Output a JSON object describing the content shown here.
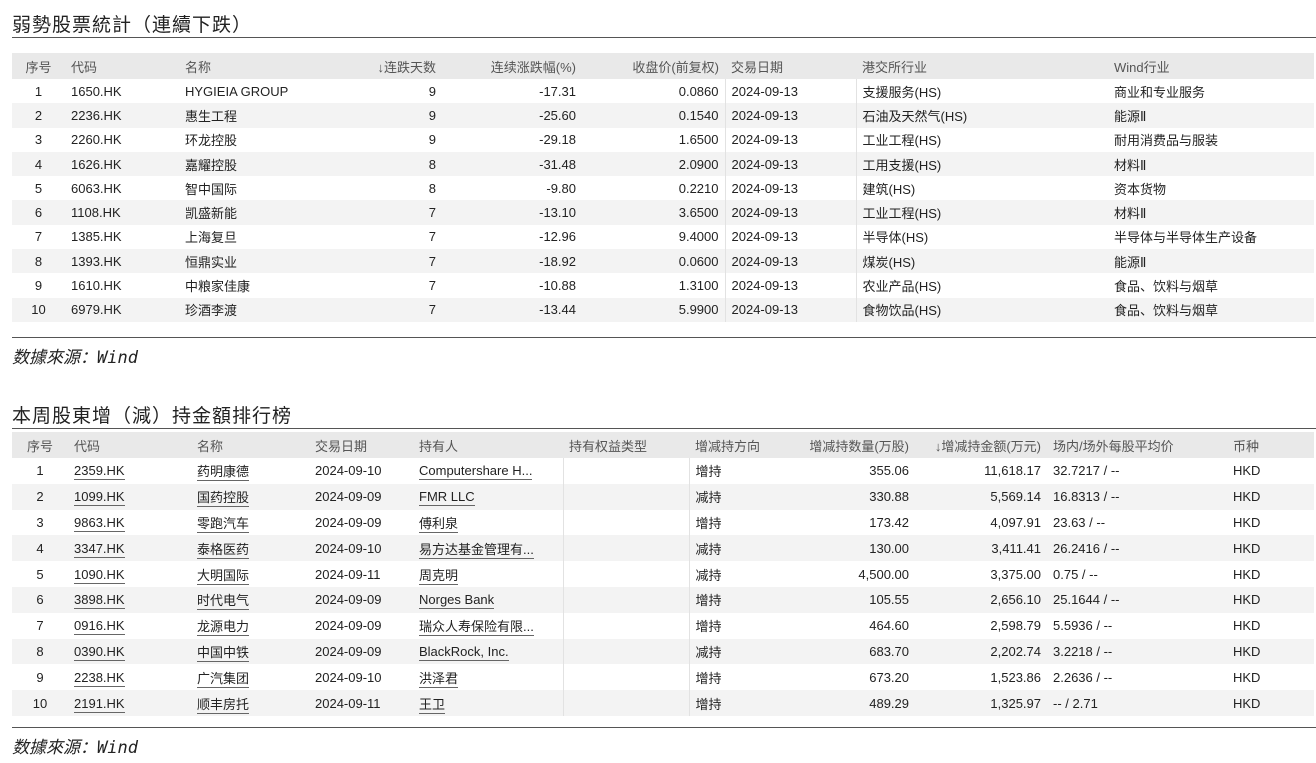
{
  "section1": {
    "title": "弱勢股票統計（連續下跌）",
    "headers": [
      "序号",
      "代码",
      "名称",
      "↓连跌天数",
      "连续涨跌幅(%)",
      "收盘价(前复权)",
      "交易日期",
      "港交所行业",
      "Wind行业"
    ],
    "rows": [
      [
        "1",
        "1650.HK",
        "HYGIEIA GROUP",
        "9",
        "-17.31",
        "0.0860",
        "2024-09-13",
        "支援服务(HS)",
        "商业和专业服务"
      ],
      [
        "2",
        "2236.HK",
        "惠生工程",
        "9",
        "-25.60",
        "0.1540",
        "2024-09-13",
        "石油及天然气(HS)",
        "能源Ⅱ"
      ],
      [
        "3",
        "2260.HK",
        "环龙控股",
        "9",
        "-29.18",
        "1.6500",
        "2024-09-13",
        "工业工程(HS)",
        "耐用消费品与服装"
      ],
      [
        "4",
        "1626.HK",
        "嘉耀控股",
        "8",
        "-31.48",
        "2.0900",
        "2024-09-13",
        "工用支援(HS)",
        "材料Ⅱ"
      ],
      [
        "5",
        "6063.HK",
        "智中国际",
        "8",
        "-9.80",
        "0.2210",
        "2024-09-13",
        "建筑(HS)",
        "资本货物"
      ],
      [
        "6",
        "1108.HK",
        "凯盛新能",
        "7",
        "-13.10",
        "3.6500",
        "2024-09-13",
        "工业工程(HS)",
        "材料Ⅱ"
      ],
      [
        "7",
        "1385.HK",
        "上海复旦",
        "7",
        "-12.96",
        "9.4000",
        "2024-09-13",
        "半导体(HS)",
        "半导体与半导体生产设备"
      ],
      [
        "8",
        "1393.HK",
        "恒鼎实业",
        "7",
        "-18.92",
        "0.0600",
        "2024-09-13",
        "煤炭(HS)",
        "能源Ⅱ"
      ],
      [
        "9",
        "1610.HK",
        "中粮家佳康",
        "7",
        "-10.88",
        "1.3100",
        "2024-09-13",
        "农业产品(HS)",
        "食品、饮料与烟草"
      ],
      [
        "10",
        "6979.HK",
        "珍酒李渡",
        "7",
        "-13.44",
        "5.9900",
        "2024-09-13",
        "食物饮品(HS)",
        "食品、饮料与烟草"
      ]
    ],
    "source": "数據來源：Wind"
  },
  "section2": {
    "title": "本周股東增（減）持金額排行榜",
    "headers": [
      "序号",
      "代码",
      "名称",
      "交易日期",
      "持有人",
      "持有权益类型",
      "增减持方向",
      "增减持数量(万股)",
      "↓增减持金额(万元)",
      "场内/场外每股平均价",
      "币种"
    ],
    "rows": [
      [
        "1",
        "2359.HK",
        "药明康德",
        "2024-09-10",
        "Computershare H...",
        "",
        "增持",
        "355.06",
        "11,618.17",
        "32.7217 / --",
        "HKD"
      ],
      [
        "2",
        "1099.HK",
        "国药控股",
        "2024-09-09",
        "FMR LLC",
        "",
        "减持",
        "330.88",
        "5,569.14",
        "16.8313 / --",
        "HKD"
      ],
      [
        "3",
        "9863.HK",
        "零跑汽车",
        "2024-09-09",
        "傅利泉",
        "",
        "增持",
        "173.42",
        "4,097.91",
        "23.63 / --",
        "HKD"
      ],
      [
        "4",
        "3347.HK",
        "泰格医药",
        "2024-09-10",
        "易方达基金管理有...",
        "",
        "减持",
        "130.00",
        "3,411.41",
        "26.2416 / --",
        "HKD"
      ],
      [
        "5",
        "1090.HK",
        "大明国际",
        "2024-09-11",
        "周克明",
        "",
        "减持",
        "4,500.00",
        "3,375.00",
        "0.75 / --",
        "HKD"
      ],
      [
        "6",
        "3898.HK",
        "时代电气",
        "2024-09-09",
        "Norges Bank",
        "",
        "增持",
        "105.55",
        "2,656.10",
        "25.1644 / --",
        "HKD"
      ],
      [
        "7",
        "0916.HK",
        "龙源电力",
        "2024-09-09",
        "瑞众人寿保险有限...",
        "",
        "增持",
        "464.60",
        "2,598.79",
        "5.5936 / --",
        "HKD"
      ],
      [
        "8",
        "0390.HK",
        "中国中铁",
        "2024-09-09",
        "BlackRock, Inc.",
        "",
        "减持",
        "683.70",
        "2,202.74",
        "3.2218 / --",
        "HKD"
      ],
      [
        "9",
        "2238.HK",
        "广汽集团",
        "2024-09-10",
        "洪泽君",
        "",
        "增持",
        "673.20",
        "1,523.86",
        "2.2636 / --",
        "HKD"
      ],
      [
        "10",
        "2191.HK",
        "顺丰房托",
        "2024-09-11",
        "王卫",
        "",
        "增持",
        "489.29",
        "1,325.97",
        "-- / 2.71",
        "HKD"
      ]
    ],
    "source": "数據來源：Wind"
  }
}
